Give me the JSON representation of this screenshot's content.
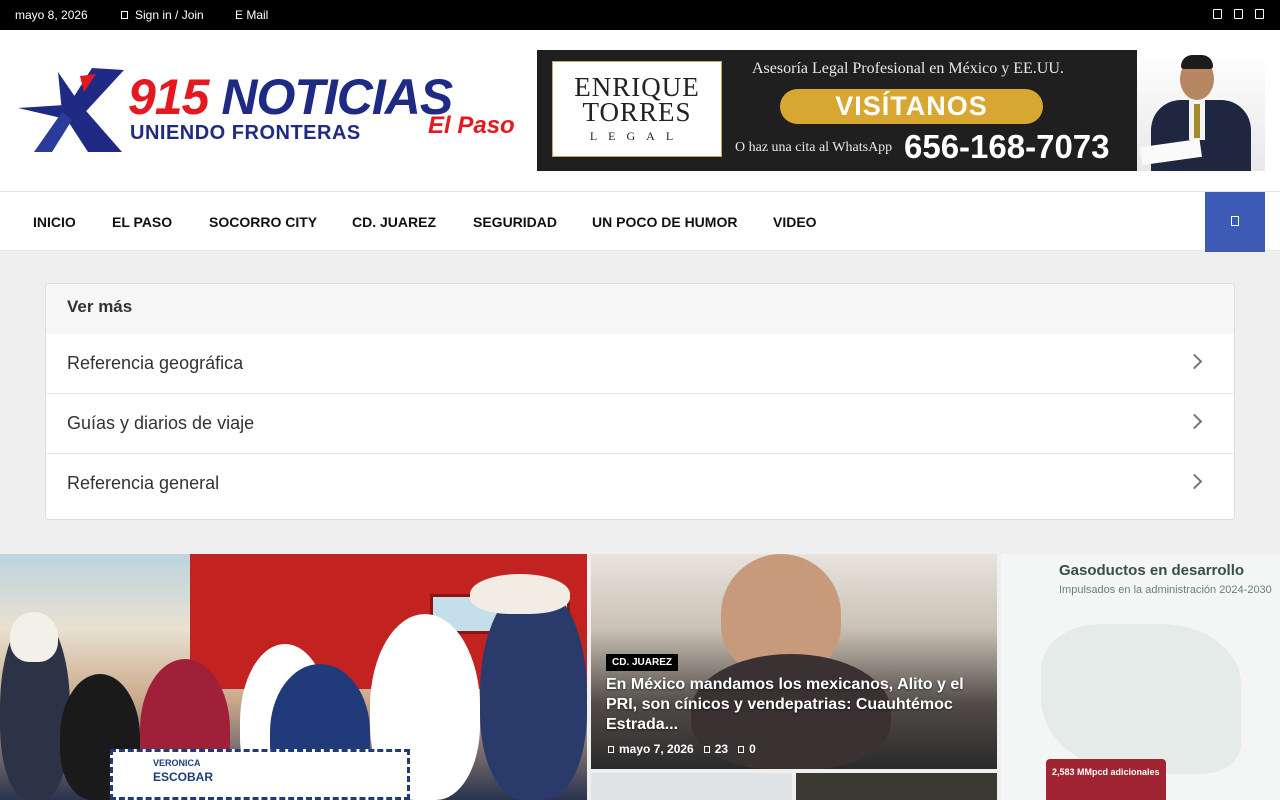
{
  "topbar": {
    "date": "mayo 8, 2026",
    "signin": "Sign in / Join",
    "email": "E Mail",
    "social_icons": [
      "facebook-icon",
      "twitter-icon",
      "youtube-icon"
    ]
  },
  "logo": {
    "number": "915",
    "name": "NOTICIAS",
    "tagline": "UNIENDO FRONTERAS",
    "city": "El Paso"
  },
  "ad": {
    "brand_line1": "ENRIQUE",
    "brand_line2": "TORRES",
    "brand_line3": "LEGAL",
    "tagline": "Asesoría Legal Profesional en México y EE.UU.",
    "cta": "VISÍTANOS",
    "sub": "O haz una cita al WhatsApp",
    "phone": "656-168-7073"
  },
  "nav": {
    "items": [
      "INICIO",
      "EL PASO",
      "SOCORRO CITY",
      "CD. JUAREZ",
      "SEGURIDAD",
      "UN POCO DE HUMOR",
      "VIDEO"
    ],
    "search_icon": "search-icon",
    "accent": "#3d5bb5"
  },
  "vermas": {
    "title": "Ver más",
    "rows": [
      "Referencia geográfica",
      "Guías y diarios de viaje",
      "Referencia general"
    ]
  },
  "news": {
    "featured_sign_line1": "VERONICA",
    "featured_sign_line2": "ESCOBAR",
    "article2": {
      "category": "CD. JUAREZ",
      "title": "En México mandamos los mexicanos, Alito y el PRI, son cínicos y vendepatrias: Cuauhtémoc Estrada...",
      "date": "mayo 7, 2026",
      "views": "23",
      "comments": "0"
    },
    "article3": {
      "heading": "Gasoductos en desarrollo",
      "sub": "Impulsados en la administración 2024-2030",
      "stat": "2,583 MMpcd adicionales"
    }
  },
  "colors": {
    "logo_red": "#e3191f",
    "logo_blue": "#1f2a85",
    "cta_gold": "#d7a732"
  }
}
